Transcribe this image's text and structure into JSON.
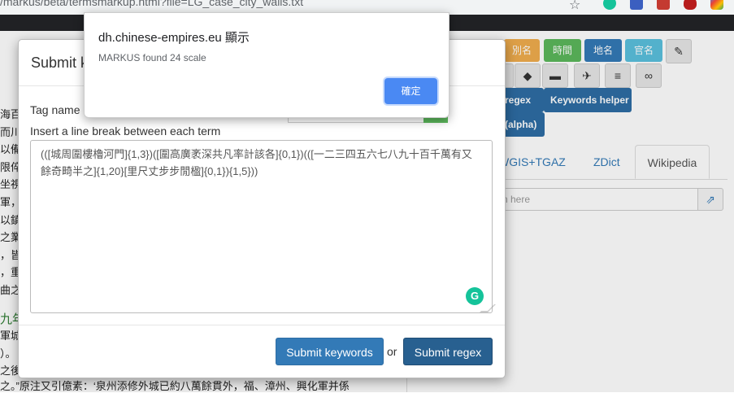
{
  "browser": {
    "url": "/markus/beta/termsmarkup.html?file=LG_case_city_walls.txt"
  },
  "page": {
    "left_text": [
      "海百",
      "而川",
      "以備",
      "限倅前",
      "坐視",
      "軍，",
      "以鎮",
      "之業",
      "，皆",
      "，重",
      "曲之"
    ],
    "left_heading": "九年",
    "left_text_lower": [
      "軍城",
      "）。",
      "之後"
    ],
    "bottom_line": "之。”原注又引億素：‘泉州添修外城已約八萬餘貫外，福、漳州、興化軍并係",
    "tag_buttons": [
      {
        "label": "別名"
      },
      {
        "label": "時間"
      },
      {
        "label": "地名"
      },
      {
        "label": "官名"
      }
    ],
    "regex_button": "regex",
    "keywords_helper_button": "Keywords helper",
    "alpha_button": "(alpha)",
    "tabs": {
      "gis": "WGIS+TGAZ",
      "zdict": "ZDict",
      "wikipedia": "Wikipedia"
    },
    "search_placeholder": "n here"
  },
  "modal": {
    "title": "Submit k",
    "tag_name_label": "Tag name (",
    "hint": "Insert a line break between each term",
    "regex_value": "(([城周圍樓櫓河門]{1,3})([圍高廣袤深共凡率計該各]{0,1})(([一二三四五六七八九十百千萬有又餘奇畸半之]{1,20}[里尺丈步步閒楹]{0,1}){1,5}))",
    "submit_keywords": "Submit keywords",
    "or": "or",
    "submit_regex": "Submit regex"
  },
  "alert": {
    "title": "dh.chinese-empires.eu 顯示",
    "message": "MARKUS found 24 scale",
    "ok_button": "確定"
  }
}
